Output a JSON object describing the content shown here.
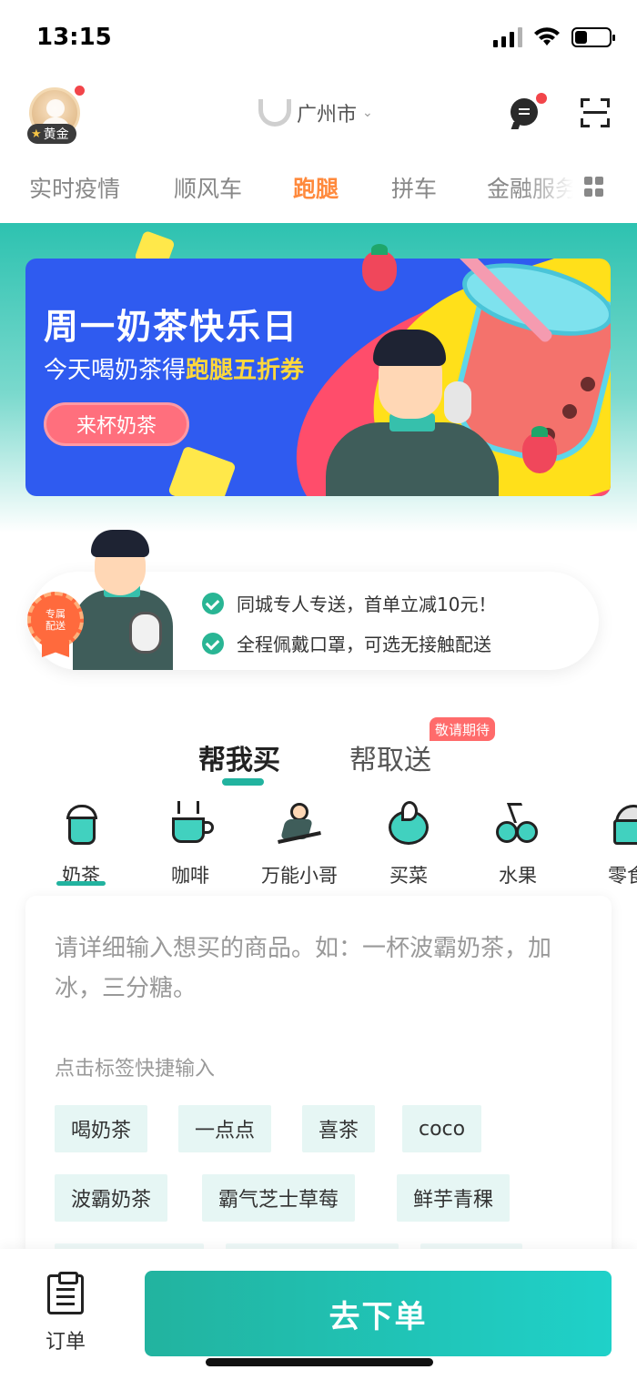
{
  "status_bar": {
    "time": "13:15",
    "battery_level": 0.35
  },
  "header": {
    "member_badge": "黄金",
    "city": "广州市"
  },
  "top_tabs": [
    {
      "label": "实时疫情",
      "active": false
    },
    {
      "label": "顺风车",
      "active": false
    },
    {
      "label": "跑腿",
      "active": true
    },
    {
      "label": "拼车",
      "active": false
    },
    {
      "label": "金融服务",
      "active": false
    }
  ],
  "banner": {
    "title": "周一奶茶快乐日",
    "subtitle_prefix": "今天喝奶茶得",
    "subtitle_highlight": "跑腿五折券",
    "cta": "来杯奶茶"
  },
  "promo": {
    "seal_line1": "专属",
    "seal_line2": "配送",
    "lines": [
      "同城专人专送，首单立减10元！",
      "全程佩戴口罩，可选无接触配送"
    ]
  },
  "service_tabs": {
    "buy": "帮我买",
    "deliver": "帮取送",
    "coming_soon": "敬请期待"
  },
  "categories": [
    "奶茶",
    "咖啡",
    "万能小哥",
    "买菜",
    "水果",
    "零食"
  ],
  "input": {
    "placeholder": "请详细输入想买的商品。如：一杯波霸奶茶，加冰，三分糖。",
    "hint": "点击标签快捷输入",
    "tags": [
      "喝奶茶",
      "一点点",
      "喜茶",
      "coco",
      "波霸奶茶",
      "霸气芝士草莓",
      "鲜芋青稞"
    ]
  },
  "bottom": {
    "orders_label": "订单",
    "submit_label": "去下单"
  },
  "colors": {
    "brand_teal": "#22b39f",
    "active_tab": "#ff8a3d",
    "banner_blue": "#2f5bf0",
    "alert_red": "#f2454a"
  }
}
